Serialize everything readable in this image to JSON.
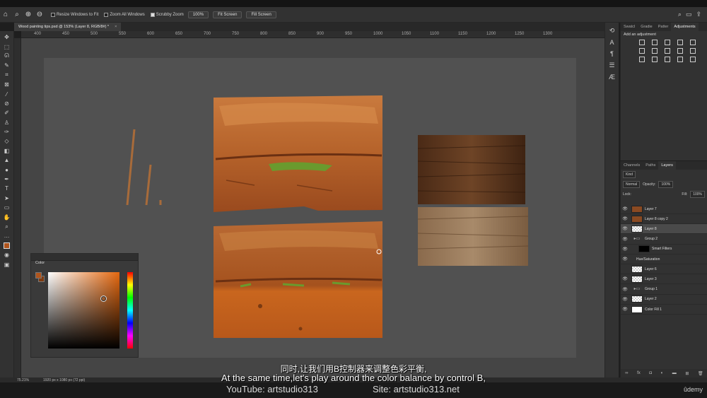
{
  "options_bar": {
    "resize_windows": "Resize Windows to Fit",
    "zoom_all": "Zoom All Windows",
    "scrubby_zoom": "Scrubby Zoom",
    "zoom_value": "100%",
    "fit_screen": "Fit Screen",
    "fill_screen": "Fill Screen"
  },
  "document_tab": {
    "title": "Wood painting tips.psd @ 153% (Layer 8, RGB/8#) *",
    "close": "×"
  },
  "ruler_marks": [
    "400",
    "450",
    "500",
    "550",
    "600",
    "650",
    "700",
    "750",
    "800",
    "850",
    "900",
    "950",
    "1000",
    "1050",
    "1100",
    "1150",
    "1200",
    "1250",
    "1300"
  ],
  "color_panel": {
    "title": "Color",
    "foreground": "#b0541c",
    "background": "#7e3a10"
  },
  "adjustments_panel": {
    "tabs": [
      "Swatcl",
      "Gradie",
      "Patter",
      "Adjustments"
    ],
    "active_tab": "Adjustments",
    "add_label": "Add an adjustment"
  },
  "layers_panel": {
    "tabs": [
      "Channels",
      "Paths",
      "Layers"
    ],
    "active_tab": "Layers",
    "kind": "Kind",
    "blend_mode": "Normal",
    "opacity_label": "Opacity:",
    "opacity": "100%",
    "lock_label": "Lock:",
    "fill_label": "Fill:",
    "fill": "100%",
    "layers": [
      {
        "name": "Layer 7",
        "visible": true,
        "selected": false,
        "indent": false,
        "kind": "brown"
      },
      {
        "name": "Layer 8 copy 2",
        "visible": true,
        "selected": false,
        "indent": false,
        "kind": "brown"
      },
      {
        "name": "Layer 8",
        "visible": true,
        "selected": true,
        "indent": false,
        "kind": "trans"
      },
      {
        "name": "Group 2",
        "visible": true,
        "selected": false,
        "indent": false,
        "kind": "folder"
      },
      {
        "name": "Smart Filters",
        "visible": true,
        "selected": false,
        "indent": true,
        "kind": "mask"
      },
      {
        "name": "Hue/Saturation",
        "visible": true,
        "selected": false,
        "indent": true,
        "kind": "none"
      },
      {
        "name": "Layer 6",
        "visible": false,
        "selected": false,
        "indent": false,
        "kind": "trans"
      },
      {
        "name": "Layer 3",
        "visible": true,
        "selected": false,
        "indent": false,
        "kind": "trans"
      },
      {
        "name": "Group 1",
        "visible": true,
        "selected": false,
        "indent": false,
        "kind": "folder"
      },
      {
        "name": "Layer 2",
        "visible": true,
        "selected": false,
        "indent": false,
        "kind": "trans"
      },
      {
        "name": "Color Fill 1",
        "visible": true,
        "selected": false,
        "indent": false,
        "kind": "fill"
      }
    ]
  },
  "status_bar": {
    "zoom": "75.21%",
    "doc_size": "1920 px x 1080 px (72 ppi)"
  },
  "subtitles": {
    "chinese": "同时,让我们用B控制器来调整色彩平衡,",
    "english": "At the same time,let's play around the color balance by control B,"
  },
  "credits": {
    "youtube": "YouTube: artstudio313",
    "site": "Site: artstudio313.net",
    "brand": "ûdemy"
  }
}
